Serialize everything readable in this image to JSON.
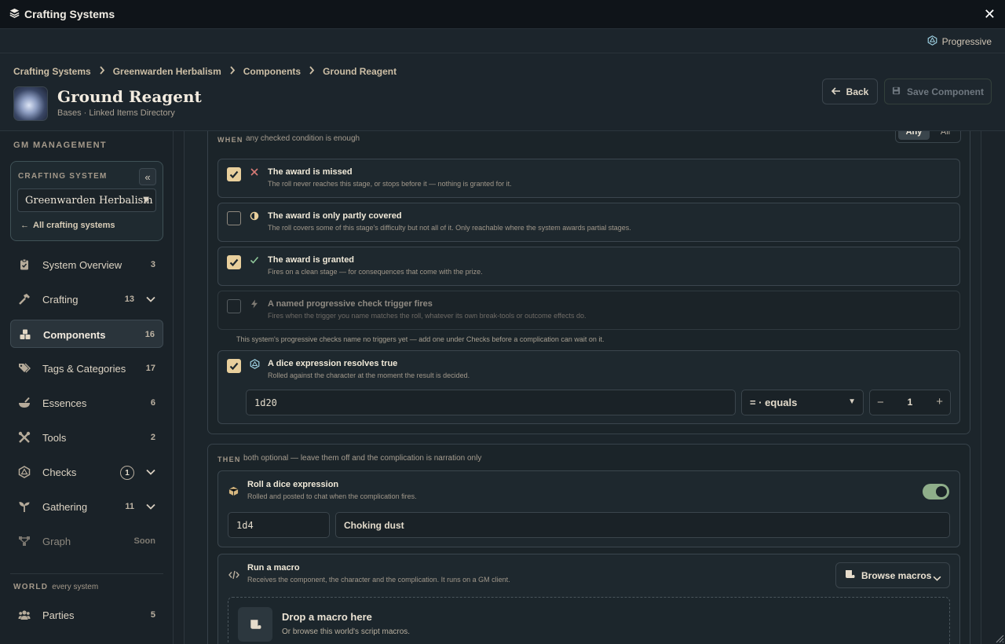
{
  "window": {
    "title": "Crafting Systems",
    "close_glyph": "✕"
  },
  "mode": {
    "label": "Progressive"
  },
  "breadcrumbs": [
    "Crafting Systems",
    "Greenwarden Herbalism",
    "Components",
    "Ground Reagent"
  ],
  "breadcrumb_sep": "›",
  "page": {
    "title": "Ground Reagent",
    "subtitle": "Bases · Linked Items Directory"
  },
  "actions": {
    "back": "Back",
    "save": "Save Component"
  },
  "sidebar": {
    "gm_label": "GM MANAGEMENT",
    "crafting_system_label": "CRAFTING SYSTEM",
    "crafting_system_value": "Greenwarden Herbalism",
    "all_systems": "All crafting systems",
    "items": [
      {
        "label": "System Overview",
        "count": "3",
        "icon": "clipboard-icon"
      },
      {
        "label": "Crafting",
        "count": "13",
        "icon": "hammer-icon",
        "expandable": true
      },
      {
        "label": "Components",
        "count": "16",
        "icon": "boxes-icon",
        "active": true
      },
      {
        "label": "Tags & Categories",
        "count": "17",
        "icon": "tags-icon"
      },
      {
        "label": "Essences",
        "count": "6",
        "icon": "mortar-icon"
      },
      {
        "label": "Tools",
        "count": "2",
        "icon": "tools-icon"
      },
      {
        "label": "Checks",
        "count": "1",
        "icon": "d20-icon",
        "expandable": true,
        "badge": true
      },
      {
        "label": "Gathering",
        "count": "11",
        "icon": "sprout-icon",
        "expandable": true
      },
      {
        "label": "Graph",
        "count": "Soon",
        "icon": "graph-icon",
        "disabled": true
      }
    ],
    "world_label": "WORLD",
    "world_hint": "every system",
    "world_items": [
      {
        "label": "Parties",
        "count": "5",
        "icon": "users-icon"
      }
    ]
  },
  "when": {
    "label": "WHEN",
    "hint": "any checked condition is enough",
    "mode_any": "Any",
    "mode_all": "All",
    "selected_mode": "Any",
    "conditions": [
      {
        "title": "The award is missed",
        "desc": "The roll never reaches this stage, or stops before it — nothing is granted for it.",
        "checked": true,
        "icon": "cross-icon"
      },
      {
        "title": "The award is only partly covered",
        "desc": "The roll covers some of this stage's difficulty but not all of it. Only reachable where the system awards partial stages.",
        "checked": false,
        "icon": "half-circle-icon"
      },
      {
        "title": "The award is granted",
        "desc": "Fires on a clean stage — for consequences that come with the prize.",
        "checked": true,
        "icon": "check-icon"
      },
      {
        "title": "A named progressive check trigger fires",
        "desc": "Fires when the trigger you name matches the roll, whatever its own break-tools or outcome effects do.",
        "checked": false,
        "icon": "bolt-icon",
        "disabled": true
      }
    ],
    "trigger_note": "This system's progressive checks name no triggers yet — add one under Checks before a complication can wait on it.",
    "dice_condition": {
      "title": "A dice expression resolves true",
      "desc": "Rolled against the character at the moment the result is decided.",
      "checked": true,
      "expression": "1d20",
      "operator": "= · equals",
      "target": "1"
    }
  },
  "then": {
    "label": "THEN",
    "hint": "both optional — leave them off and the complication is narration only",
    "roll": {
      "title": "Roll a dice expression",
      "desc": "Rolled and posted to chat when the complication fires.",
      "enabled": true,
      "formula": "1d4",
      "flavor": "Choking dust"
    },
    "macro": {
      "title": "Run a macro",
      "desc": "Receives the component, the character and the complication. It runs on a GM client.",
      "browse": "Browse macros",
      "drop_title": "Drop a macro here",
      "drop_desc": "Or browse this world's script macros."
    }
  },
  "colors": {
    "accent": "#e8cf9c",
    "toggle_on": "#8fae8a",
    "background": "#1a2228"
  }
}
